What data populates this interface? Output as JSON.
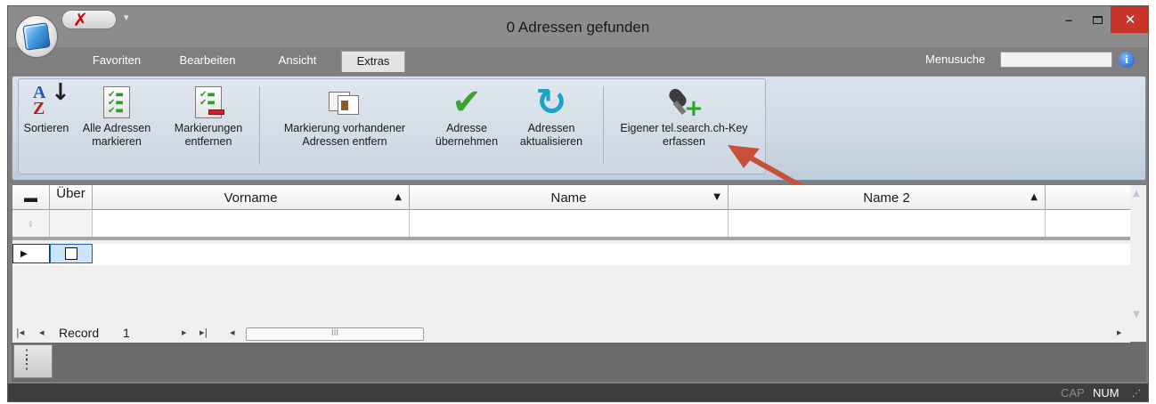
{
  "window": {
    "title": "0 Adressen gefunden",
    "min_symbol": "–",
    "close_symbol": "✕",
    "qat_symbol": "✗",
    "qat_dropdown": "▾"
  },
  "tabs": [
    "Favoriten",
    "Bearbeiten",
    "Ansicht",
    "Extras"
  ],
  "active_tab": "Extras",
  "menu_search": {
    "label": "Menusuche",
    "value": "",
    "info_symbol": "i"
  },
  "ribbon": {
    "buttons": [
      {
        "line1": "Sortieren",
        "line2": ""
      },
      {
        "line1": "Alle Adressen",
        "line2": "markieren"
      },
      {
        "line1": "Markierungen",
        "line2": "entfernen"
      },
      {
        "line1": "Markierung vorhandener",
        "line2": "Adressen entfern"
      },
      {
        "line1": "Adresse",
        "line2": "übernehmen"
      },
      {
        "line1": "Adressen",
        "line2": "aktualisieren"
      },
      {
        "line1": "Eigener tel.search.ch-Key",
        "line2": "erfassen"
      }
    ]
  },
  "grid": {
    "columns": [
      {
        "label": "Über",
        "sort": ""
      },
      {
        "label": "Vorname",
        "sort": "▲"
      },
      {
        "label": "Name",
        "sort": "▼"
      },
      {
        "label": "Name 2",
        "sort": "▲"
      }
    ],
    "collapse_symbol": "▬",
    "filter_symbol": "♀",
    "row_arrow": "▶",
    "navigator": {
      "first": "|◂",
      "prev": "◂",
      "record_label": "Record",
      "record_value": "1",
      "next": "▸",
      "last": "▸|",
      "scroll_left": "◂",
      "scroll_thumb": "III",
      "scroll_right": "▸"
    }
  },
  "status": {
    "cap": "CAP",
    "num": "NUM",
    "grip": "⋰"
  },
  "colors": {
    "annotation_arrow": "#c8503a",
    "close_button": "#c8352b",
    "ribbon": "#cdd8e4"
  }
}
